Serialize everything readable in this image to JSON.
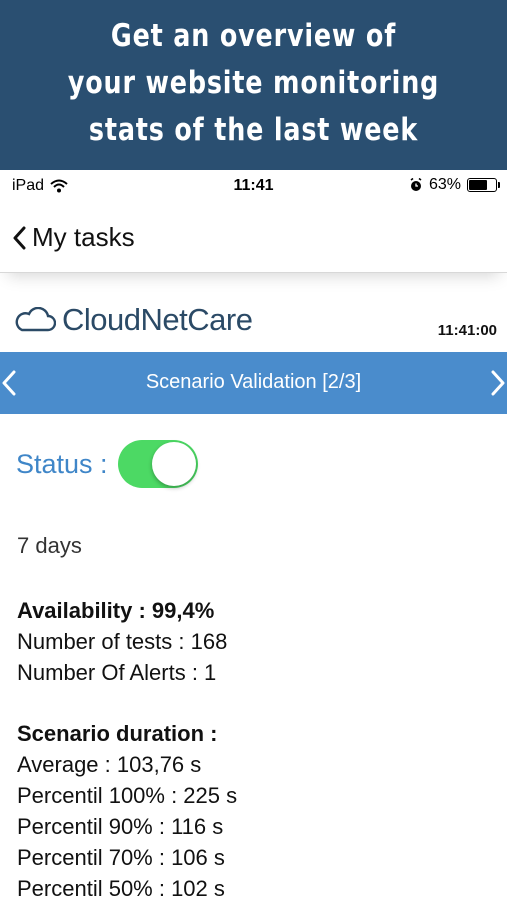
{
  "promo": {
    "lines": [
      "Get an overview of",
      "your website monitoring",
      "stats of the last week"
    ]
  },
  "status_bar": {
    "device": "iPad",
    "time": "11:41",
    "battery": "63%",
    "battery_level": 0.63
  },
  "nav": {
    "back_label": "My tasks"
  },
  "brand": {
    "name": "CloudNetCare",
    "clock": "11:41:00"
  },
  "scenario": {
    "title": "Scenario Validation [2/3]"
  },
  "status": {
    "label": "Status :",
    "toggle_on": true
  },
  "stats": {
    "period": "7 days",
    "availability": "Availability : 99,4%",
    "tests": "Number of tests : 168",
    "alerts": "Number Of Alerts : 1",
    "duration_header": "Scenario duration :",
    "average": "Average : 103,76 s",
    "p100": "Percentil 100% : 225 s",
    "p90": "Percentil 90% : 116 s",
    "p70": "Percentil 70% : 106 s",
    "p50": "Percentil 50% : 102 s"
  },
  "colors": {
    "banner": "#2a4f71",
    "scenario_bar": "#4a8ccc",
    "status_label": "#3f86c8",
    "toggle_on": "#4cd964"
  }
}
